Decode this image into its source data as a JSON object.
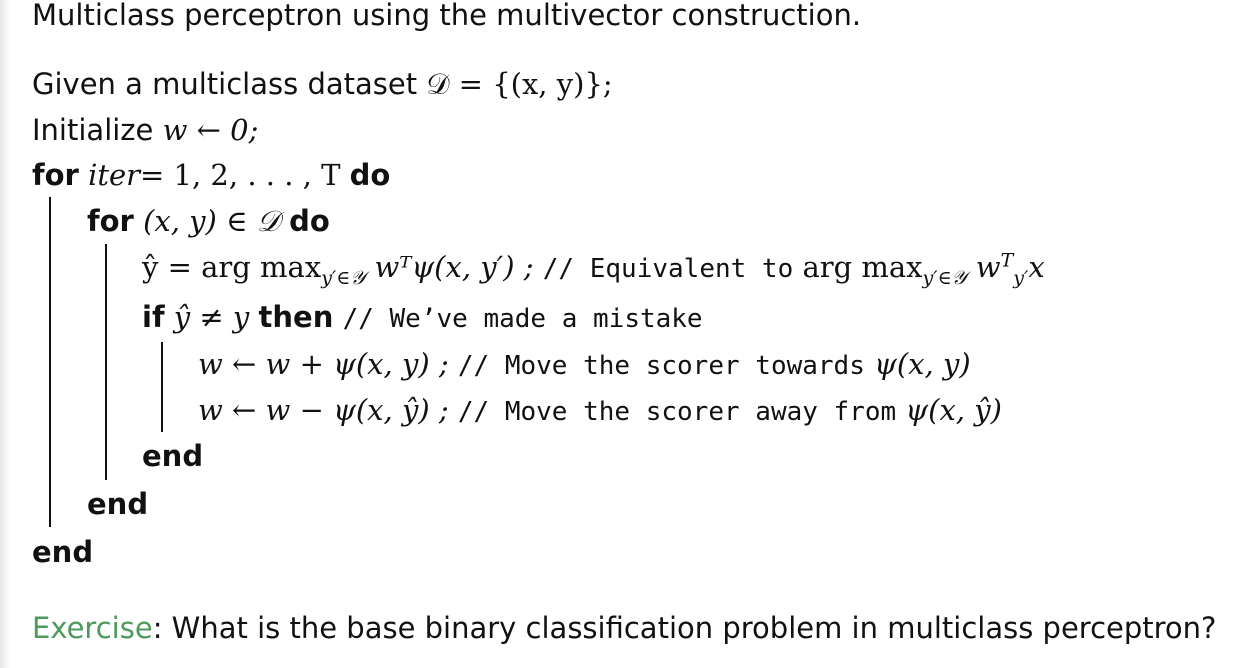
{
  "heading": "Multiclass perceptron using the multivector construction.",
  "algorithm": {
    "given_prefix": "Given a multiclass dataset",
    "given_math": "𝒟 = {(x, y)};",
    "init_prefix": "Initialize",
    "init_math": "w ← 0;",
    "for_kw": "for",
    "iter_var": "iter",
    "iter_range": "= 1, 2, . . . , T",
    "do_kw": "do",
    "inner_for_math": "(x, y) ∈ 𝒟",
    "yhat_lhs": "ŷ = arg max",
    "yhat_sub": "y′∈𝒴",
    "yhat_rhs": "wᵀψ(x, y′) ;",
    "comment1": "// Equivalent to",
    "comment1_math": "arg max",
    "comment1_sub": "y′∈𝒴",
    "comment1_tail": "w",
    "comment1_tail_sup": "T",
    "comment1_tail_sub": "y′",
    "comment1_end": "x",
    "if_kw": "if",
    "if_cond": "ŷ ≠ y",
    "then_kw": "then",
    "comment2": "// We’ve made a mistake",
    "update1": "w ← w + ψ(x, y) ;",
    "comment3": "// Move the scorer towards",
    "comment3_math": "ψ(x, y)",
    "update2": "w ← w − ψ(x, ŷ) ;",
    "comment4": "// Move the scorer away from",
    "comment4_math": "ψ(x, ŷ)",
    "end_kw": "end"
  },
  "exercise": {
    "label": "Exercise",
    "text": ": What is the base binary classification problem in multiclass perceptron?"
  },
  "colors": {
    "exercise_label": "#4d9a5a",
    "text": "#111111"
  }
}
